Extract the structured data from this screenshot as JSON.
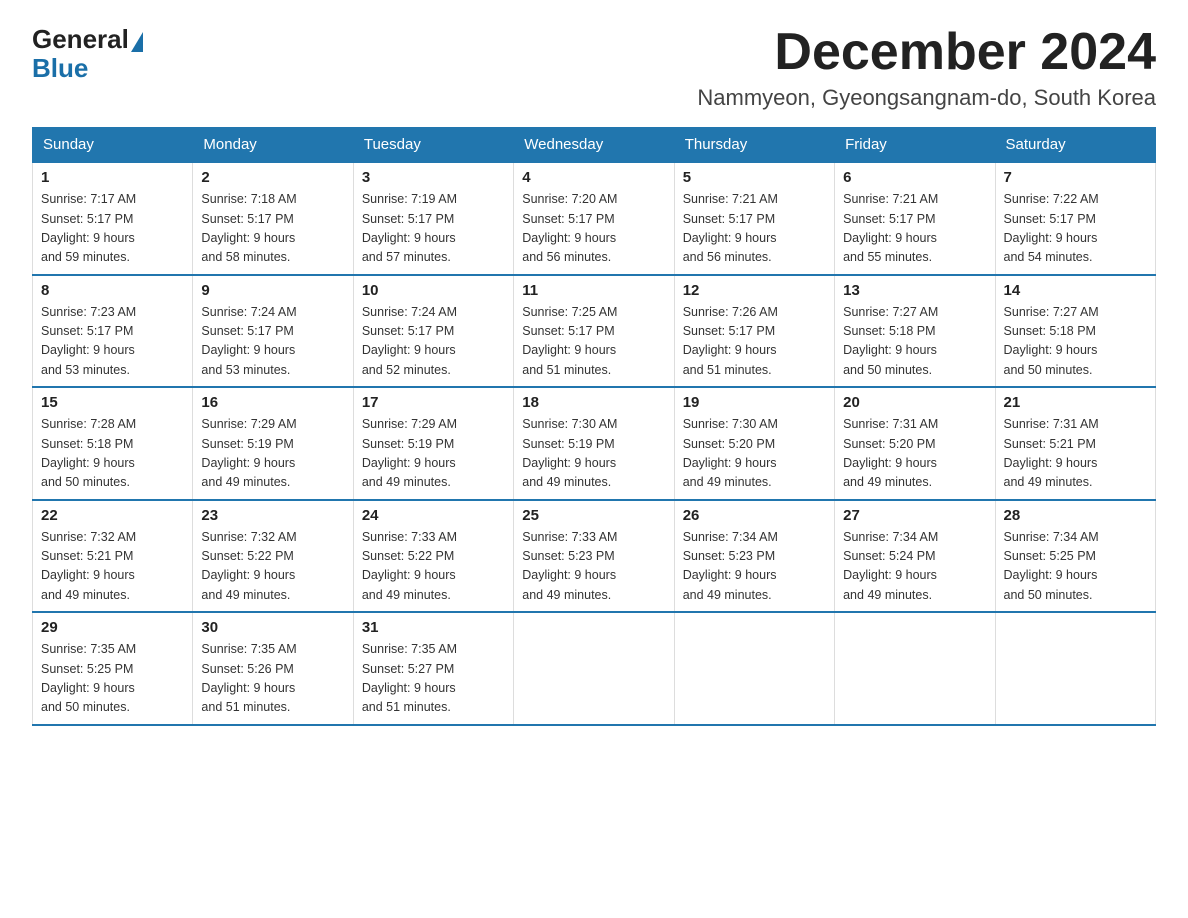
{
  "logo": {
    "general": "General",
    "blue": "Blue"
  },
  "title": "December 2024",
  "location": "Nammyeon, Gyeongsangnam-do, South Korea",
  "headers": [
    "Sunday",
    "Monday",
    "Tuesday",
    "Wednesday",
    "Thursday",
    "Friday",
    "Saturday"
  ],
  "weeks": [
    [
      {
        "day": "1",
        "sunrise": "7:17 AM",
        "sunset": "5:17 PM",
        "daylight": "9 hours and 59 minutes."
      },
      {
        "day": "2",
        "sunrise": "7:18 AM",
        "sunset": "5:17 PM",
        "daylight": "9 hours and 58 minutes."
      },
      {
        "day": "3",
        "sunrise": "7:19 AM",
        "sunset": "5:17 PM",
        "daylight": "9 hours and 57 minutes."
      },
      {
        "day": "4",
        "sunrise": "7:20 AM",
        "sunset": "5:17 PM",
        "daylight": "9 hours and 56 minutes."
      },
      {
        "day": "5",
        "sunrise": "7:21 AM",
        "sunset": "5:17 PM",
        "daylight": "9 hours and 56 minutes."
      },
      {
        "day": "6",
        "sunrise": "7:21 AM",
        "sunset": "5:17 PM",
        "daylight": "9 hours and 55 minutes."
      },
      {
        "day": "7",
        "sunrise": "7:22 AM",
        "sunset": "5:17 PM",
        "daylight": "9 hours and 54 minutes."
      }
    ],
    [
      {
        "day": "8",
        "sunrise": "7:23 AM",
        "sunset": "5:17 PM",
        "daylight": "9 hours and 53 minutes."
      },
      {
        "day": "9",
        "sunrise": "7:24 AM",
        "sunset": "5:17 PM",
        "daylight": "9 hours and 53 minutes."
      },
      {
        "day": "10",
        "sunrise": "7:24 AM",
        "sunset": "5:17 PM",
        "daylight": "9 hours and 52 minutes."
      },
      {
        "day": "11",
        "sunrise": "7:25 AM",
        "sunset": "5:17 PM",
        "daylight": "9 hours and 51 minutes."
      },
      {
        "day": "12",
        "sunrise": "7:26 AM",
        "sunset": "5:17 PM",
        "daylight": "9 hours and 51 minutes."
      },
      {
        "day": "13",
        "sunrise": "7:27 AM",
        "sunset": "5:18 PM",
        "daylight": "9 hours and 50 minutes."
      },
      {
        "day": "14",
        "sunrise": "7:27 AM",
        "sunset": "5:18 PM",
        "daylight": "9 hours and 50 minutes."
      }
    ],
    [
      {
        "day": "15",
        "sunrise": "7:28 AM",
        "sunset": "5:18 PM",
        "daylight": "9 hours and 50 minutes."
      },
      {
        "day": "16",
        "sunrise": "7:29 AM",
        "sunset": "5:19 PM",
        "daylight": "9 hours and 49 minutes."
      },
      {
        "day": "17",
        "sunrise": "7:29 AM",
        "sunset": "5:19 PM",
        "daylight": "9 hours and 49 minutes."
      },
      {
        "day": "18",
        "sunrise": "7:30 AM",
        "sunset": "5:19 PM",
        "daylight": "9 hours and 49 minutes."
      },
      {
        "day": "19",
        "sunrise": "7:30 AM",
        "sunset": "5:20 PM",
        "daylight": "9 hours and 49 minutes."
      },
      {
        "day": "20",
        "sunrise": "7:31 AM",
        "sunset": "5:20 PM",
        "daylight": "9 hours and 49 minutes."
      },
      {
        "day": "21",
        "sunrise": "7:31 AM",
        "sunset": "5:21 PM",
        "daylight": "9 hours and 49 minutes."
      }
    ],
    [
      {
        "day": "22",
        "sunrise": "7:32 AM",
        "sunset": "5:21 PM",
        "daylight": "9 hours and 49 minutes."
      },
      {
        "day": "23",
        "sunrise": "7:32 AM",
        "sunset": "5:22 PM",
        "daylight": "9 hours and 49 minutes."
      },
      {
        "day": "24",
        "sunrise": "7:33 AM",
        "sunset": "5:22 PM",
        "daylight": "9 hours and 49 minutes."
      },
      {
        "day": "25",
        "sunrise": "7:33 AM",
        "sunset": "5:23 PM",
        "daylight": "9 hours and 49 minutes."
      },
      {
        "day": "26",
        "sunrise": "7:34 AM",
        "sunset": "5:23 PM",
        "daylight": "9 hours and 49 minutes."
      },
      {
        "day": "27",
        "sunrise": "7:34 AM",
        "sunset": "5:24 PM",
        "daylight": "9 hours and 49 minutes."
      },
      {
        "day": "28",
        "sunrise": "7:34 AM",
        "sunset": "5:25 PM",
        "daylight": "9 hours and 50 minutes."
      }
    ],
    [
      {
        "day": "29",
        "sunrise": "7:35 AM",
        "sunset": "5:25 PM",
        "daylight": "9 hours and 50 minutes."
      },
      {
        "day": "30",
        "sunrise": "7:35 AM",
        "sunset": "5:26 PM",
        "daylight": "9 hours and 51 minutes."
      },
      {
        "day": "31",
        "sunrise": "7:35 AM",
        "sunset": "5:27 PM",
        "daylight": "9 hours and 51 minutes."
      },
      null,
      null,
      null,
      null
    ]
  ],
  "labels": {
    "sunrise": "Sunrise:",
    "sunset": "Sunset:",
    "daylight": "Daylight:"
  }
}
